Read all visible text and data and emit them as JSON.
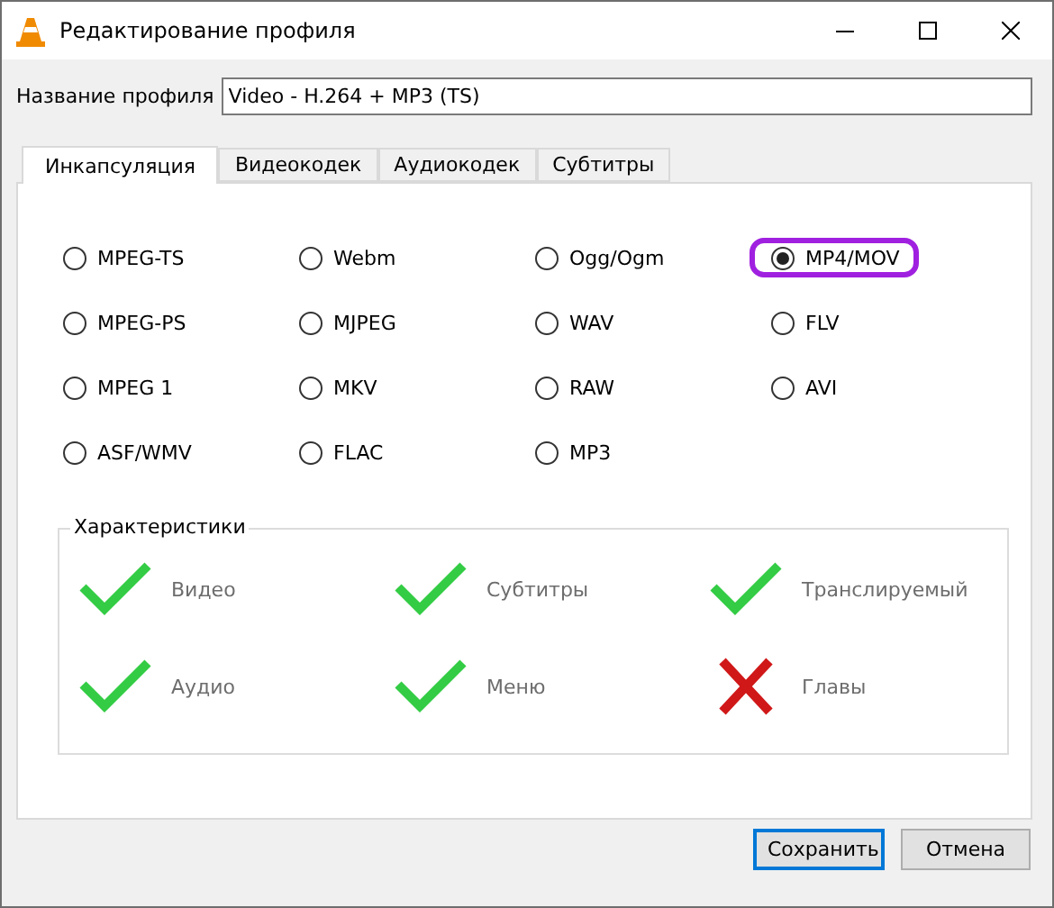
{
  "window": {
    "title": "Редактирование профиля"
  },
  "profile_name": {
    "label": "Название профиля",
    "value": "Video - H.264 + MP3 (TS)"
  },
  "tabs": [
    {
      "label": "Инкапсуляция",
      "selected": true
    },
    {
      "label": "Видеокодек",
      "selected": false
    },
    {
      "label": "Аудиокодек",
      "selected": false
    },
    {
      "label": "Субтитры",
      "selected": false
    }
  ],
  "encapsulation": {
    "options": [
      {
        "label": "MPEG-TS",
        "selected": false,
        "highlighted": false
      },
      {
        "label": "Webm",
        "selected": false,
        "highlighted": false
      },
      {
        "label": "Ogg/Ogm",
        "selected": false,
        "highlighted": false
      },
      {
        "label": "MP4/MOV",
        "selected": true,
        "highlighted": true
      },
      {
        "label": "MPEG-PS",
        "selected": false,
        "highlighted": false
      },
      {
        "label": "MJPEG",
        "selected": false,
        "highlighted": false
      },
      {
        "label": "WAV",
        "selected": false,
        "highlighted": false
      },
      {
        "label": "FLV",
        "selected": false,
        "highlighted": false
      },
      {
        "label": "MPEG 1",
        "selected": false,
        "highlighted": false
      },
      {
        "label": "MKV",
        "selected": false,
        "highlighted": false
      },
      {
        "label": "RAW",
        "selected": false,
        "highlighted": false
      },
      {
        "label": "AVI",
        "selected": false,
        "highlighted": false
      },
      {
        "label": "ASF/WMV",
        "selected": false,
        "highlighted": false
      },
      {
        "label": "FLAC",
        "selected": false,
        "highlighted": false
      },
      {
        "label": "MP3",
        "selected": false,
        "highlighted": false
      }
    ]
  },
  "features": {
    "title": "Характеристики",
    "items": [
      {
        "label": "Видео",
        "supported": true
      },
      {
        "label": "Субтитры",
        "supported": true
      },
      {
        "label": "Транслируемый",
        "supported": true
      },
      {
        "label": "Аудио",
        "supported": true
      },
      {
        "label": "Меню",
        "supported": true
      },
      {
        "label": "Главы",
        "supported": false
      }
    ]
  },
  "buttons": [
    {
      "label": "Сохранить",
      "default": true
    },
    {
      "label": "Отмена",
      "default": false
    }
  ]
}
